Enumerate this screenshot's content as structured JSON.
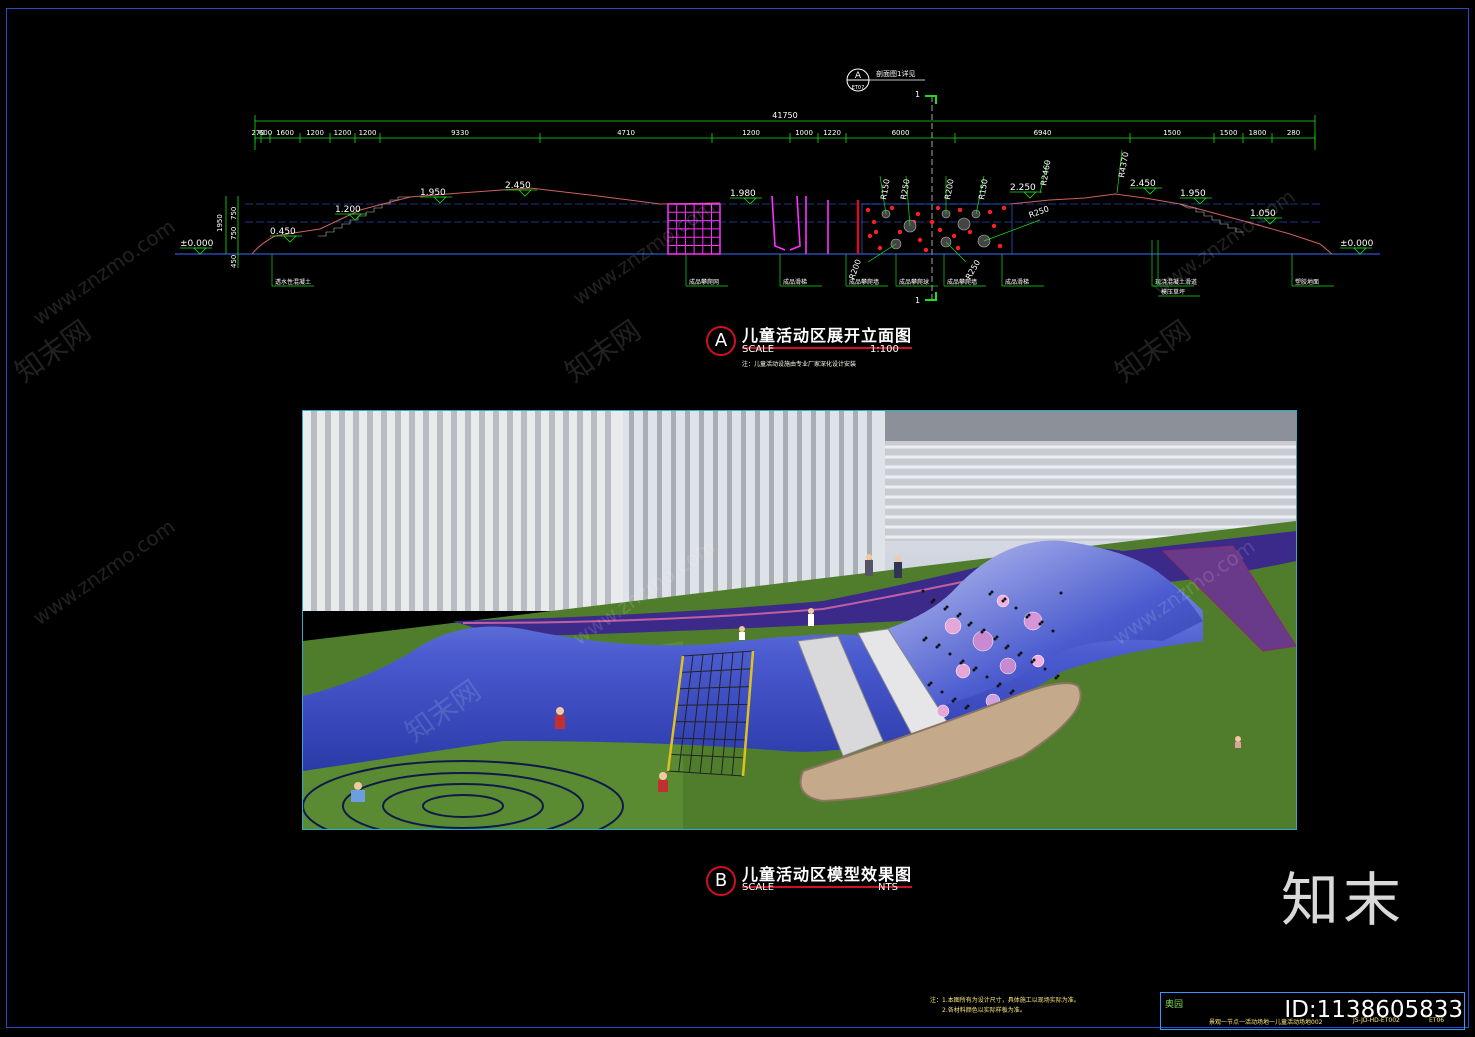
{
  "section_a": {
    "callout_letter": "A",
    "callout_ref": "ET07",
    "callout_note": "剖面图1详见",
    "cut_mark": "1",
    "title": "儿童活动区展开立面图",
    "scale_label": "SCALE",
    "scale_value": "1:100",
    "note": "注：儿童活动设施由专业厂家深化设计安装",
    "overall_dim": "41750",
    "dims": [
      "270",
      "600",
      "1600",
      "1200",
      "1200",
      "1200",
      "9330",
      "4710",
      "1200",
      "1000",
      "1220",
      "6000",
      "6940",
      "1500",
      "1500",
      "1800",
      "280"
    ],
    "elevations": [
      "±0.000",
      "0.450",
      "1.200",
      "1.950",
      "2.450",
      "1.980",
      "2.250",
      "2.450",
      "1.950",
      "1.050",
      "±0.000"
    ],
    "vertical_dims": [
      "1950",
      "750",
      "750",
      "450"
    ],
    "radii": [
      "R150",
      "R250",
      "R200",
      "R150",
      "R250",
      "R200",
      "R250",
      "R2460",
      "R4370"
    ],
    "labels": [
      "透水性混凝土",
      "成品攀爬网",
      "成品滑梯",
      "成品攀爬墙",
      "成品攀爬球",
      "成品攀爬墙",
      "成品滑梯",
      "现浇混凝土滑道",
      "模压草坪",
      "塑胶地面"
    ]
  },
  "section_b": {
    "letter": "B",
    "title": "儿童活动区模型效果图",
    "scale_label": "SCALE",
    "scale_value": "NTS"
  },
  "notes": [
    "注：1.本图所有为设计尺寸，具体施工以现场实际为准。",
    "2.各材料颜色以实际样板为准。"
  ],
  "title_block": {
    "logo": "奥园",
    "project": "景观一节点一活动场地一儿童活动场地002",
    "drawing_no": "JS-JD-HD-ET002",
    "sheet": "ET06"
  },
  "watermark": "www.znzmo.com",
  "watermark_cn": "知末网",
  "brand": "知末",
  "id_text": "ID:1138605833",
  "colors": {
    "frame": "#2a4ad0",
    "dimension": "#18e018",
    "ground": "#3a6cff",
    "profile": "#d06060",
    "magenta": "#ff30ff",
    "accent_red": "#d01020"
  }
}
